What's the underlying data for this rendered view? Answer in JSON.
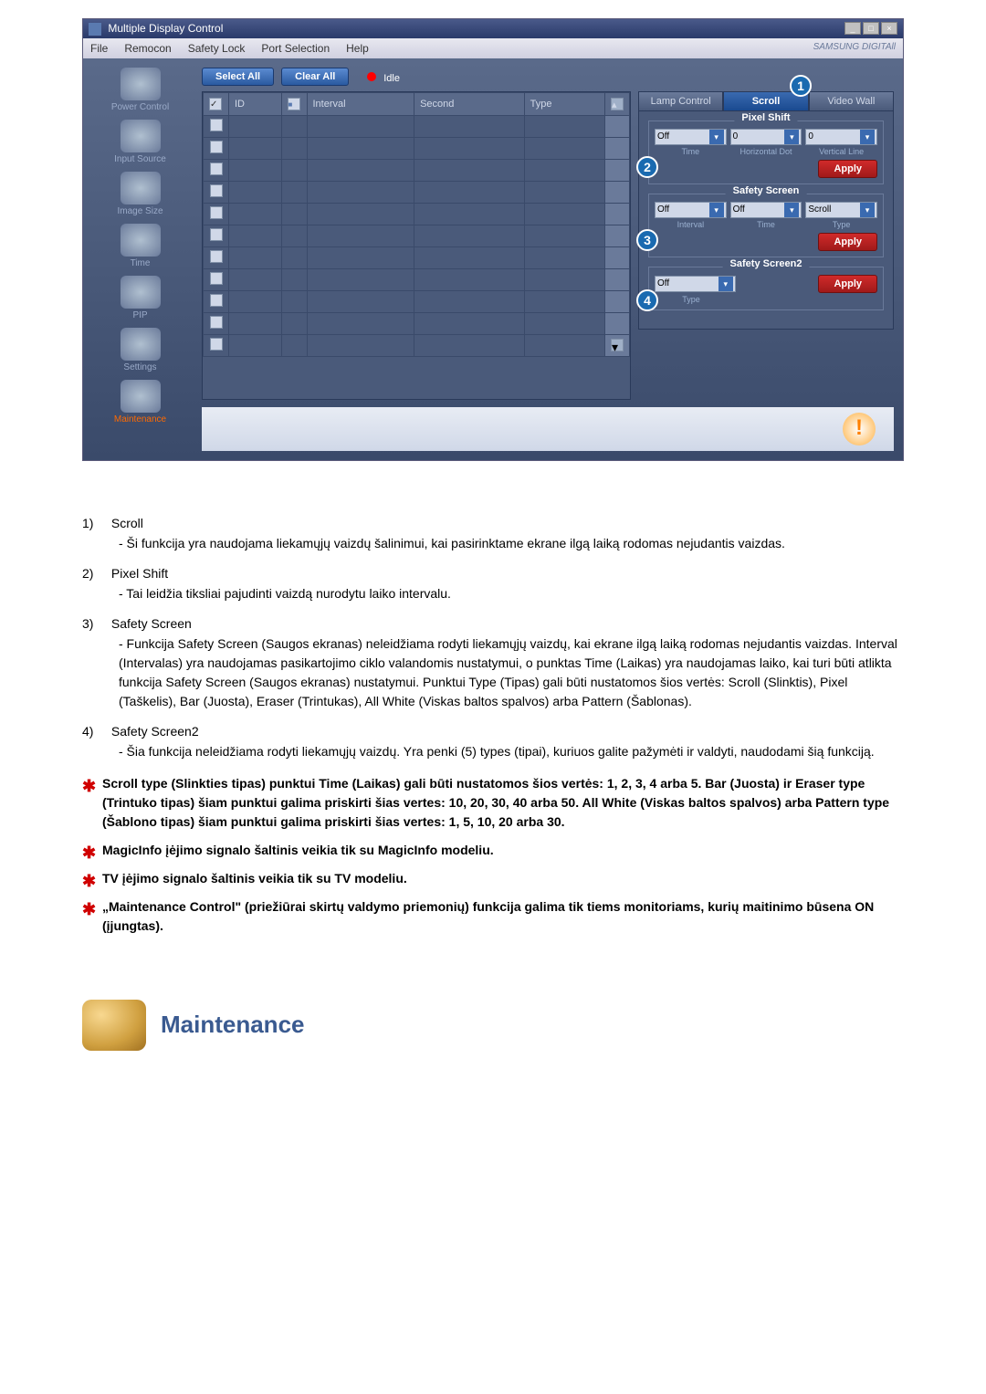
{
  "window": {
    "title": "Multiple Display Control",
    "brand": "SAMSUNG DIGITAll"
  },
  "menu": {
    "file": "File",
    "remocon": "Remocon",
    "safetyLock": "Safety Lock",
    "portSelection": "Port Selection",
    "help": "Help"
  },
  "sidebar": {
    "items": [
      {
        "label": "Power Control"
      },
      {
        "label": "Input Source"
      },
      {
        "label": "Image Size"
      },
      {
        "label": "Time"
      },
      {
        "label": "PIP"
      },
      {
        "label": "Settings"
      },
      {
        "label": "Maintenance"
      }
    ]
  },
  "toolbar": {
    "selectAll": "Select All",
    "clearAll": "Clear All",
    "statusLabel": "Idle"
  },
  "table": {
    "headers": {
      "id": "ID",
      "icon": "",
      "interval": "Interval",
      "second": "Second",
      "type": "Type"
    }
  },
  "tabs": {
    "lamp": "Lamp Control",
    "scroll": "Scroll",
    "video": "Video Wall"
  },
  "callouts": {
    "c1": "1",
    "c2": "2",
    "c3": "3",
    "c4": "4"
  },
  "pixelShift": {
    "title": "Pixel Shift",
    "time": "Off",
    "timeLabel": "Time",
    "hdot": "0",
    "hdotLabel": "Horizontal Dot",
    "vline": "0",
    "vlineLabel": "Vertical Line",
    "apply": "Apply"
  },
  "safetyScreen": {
    "title": "Safety Screen",
    "interval": "Off",
    "intervalLabel": "Interval",
    "time": "Off",
    "timeLabel": "Time",
    "type": "Scroll",
    "typeLabel": "Type",
    "apply": "Apply"
  },
  "safetyScreen2": {
    "title": "Safety Screen2",
    "type": "Off",
    "typeLabel": "Type",
    "apply": "Apply"
  },
  "doc": {
    "items": [
      {
        "num": "1)",
        "title": "Scroll",
        "desc": "- Ši funkcija yra naudojama liekamųjų vaizdų šalinimui, kai pasirinktame ekrane ilgą laiką rodomas nejudantis vaizdas."
      },
      {
        "num": "2)",
        "title": "Pixel Shift",
        "desc": "- Tai leidžia tiksliai pajudinti vaizdą nurodytu laiko intervalu."
      },
      {
        "num": "3)",
        "title": "Safety Screen",
        "desc": "- Funkcija Safety Screen (Saugos ekranas) neleidžiama rodyti liekamųjų vaizdų, kai ekrane ilgą laiką rodomas nejudantis vaizdas.  Interval (Intervalas) yra naudojamas pasikartojimo ciklo valandomis nustatymui, o punktas Time (Laikas) yra naudojamas laiko, kai turi būti atlikta funkcija Safety Screen (Saugos ekranas) nustatymui. Punktui Type (Tipas) gali būti nustatomos šios vertės: Scroll (Slinktis), Pixel (Taškelis), Bar (Juosta), Eraser (Trintukas), All White (Viskas baltos spalvos) arba Pattern (Šablonas)."
      },
      {
        "num": "4)",
        "title": "Safety Screen2",
        "desc": "- Šia funkcija neleidžiama rodyti liekamųjų vaizdų. Yra penki (5) types (tipai), kuriuos galite pažymėti ir valdyti, naudodami šią funkciją."
      }
    ],
    "notes": [
      "Scroll type (Slinkties tipas) punktui Time (Laikas) gali būti nustatomos šios vertės: 1, 2, 3, 4 arba 5. Bar (Juosta) ir Eraser type (Trintuko tipas) šiam punktui galima priskirti šias vertes: 10, 20, 30, 40 arba 50. All White (Viskas baltos spalvos) arba Pattern type (Šablono tipas) šiam punktui galima priskirti šias vertes: 1, 5, 10, 20 arba 30.",
      "MagicInfo įėjimo signalo šaltinis veikia tik su MagicInfo modeliu.",
      "TV įėjimo signalo šaltinis veikia tik su TV modeliu.",
      "„Maintenance Control\" (priežiūrai skirtų valdymo priemonių) funkcija galima tik tiems monitoriams, kurių maitinimo būsena ON (įjungtas)."
    ]
  },
  "section": {
    "title": "Maintenance"
  }
}
